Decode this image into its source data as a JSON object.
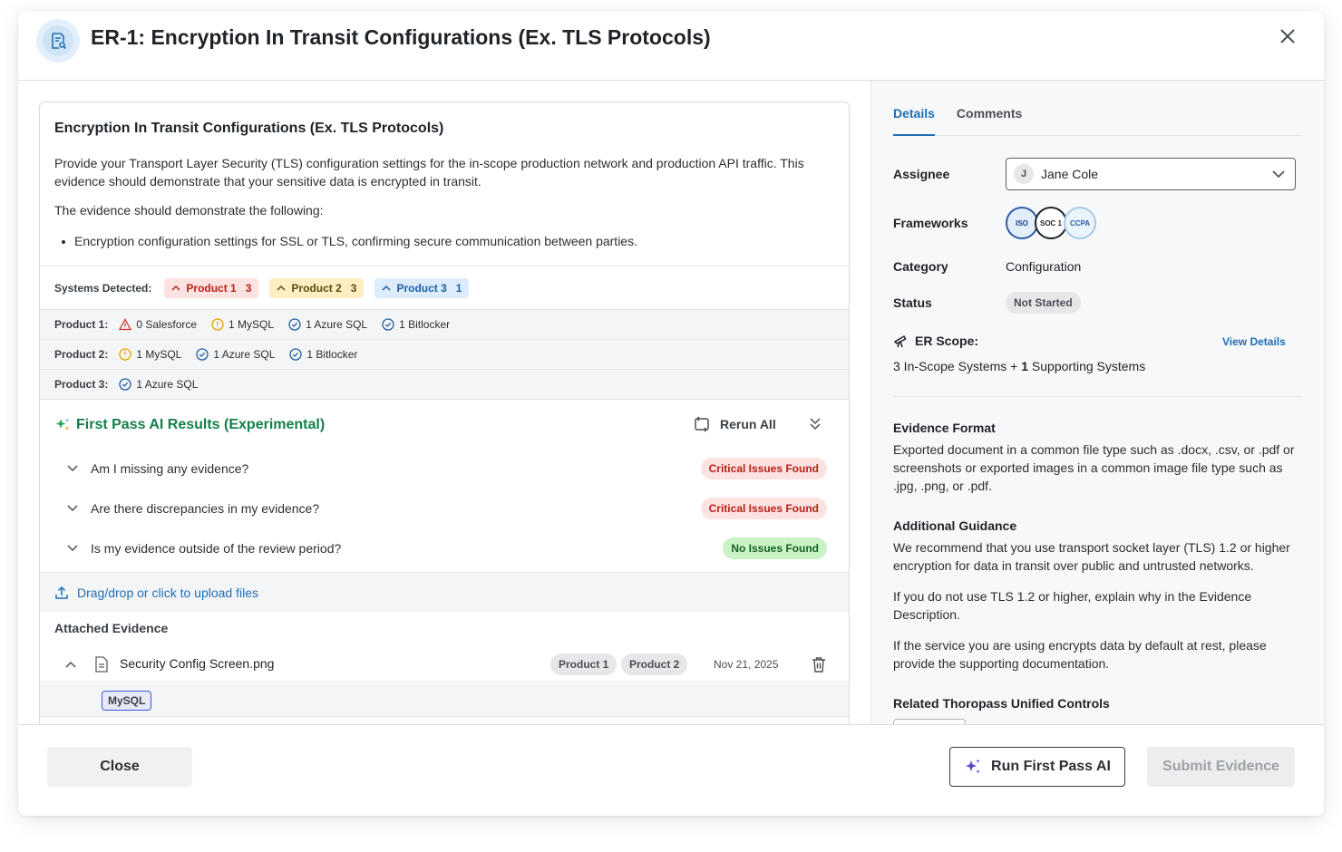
{
  "header": {
    "title": "ER-1: Encryption In Transit Configurations (Ex. TLS Protocols)"
  },
  "card": {
    "title": "Encryption In Transit Configurations (Ex. TLS Protocols)",
    "description": "Provide your Transport Layer Security (TLS) configuration settings for the in-scope production network and production API traffic. This evidence should demonstrate that your sensitive data is encrypted in transit.",
    "demonstrate_intro": "The evidence should demonstrate the following:",
    "bullet": "Encryption configuration settings for SSL or TLS, confirming secure communication between parties."
  },
  "systems": {
    "label": "Systems Detected:",
    "chips": [
      {
        "name": "Product 1",
        "count": "3",
        "color": "#fde2e2"
      },
      {
        "name": "Product 2",
        "count": "3",
        "color": "#fdefc2"
      },
      {
        "name": "Product 3",
        "count": "1",
        "color": "#dcecfb"
      }
    ]
  },
  "products": [
    {
      "label": "Product 1:",
      "items": [
        {
          "icon": "warning-triangle-icon",
          "text": "0 Salesforce"
        },
        {
          "icon": "exclamation-circle-icon",
          "text": "1 MySQL"
        },
        {
          "icon": "check-circle-icon",
          "text": "1 Azure SQL"
        },
        {
          "icon": "check-circle-icon",
          "text": "1 Bitlocker"
        }
      ]
    },
    {
      "label": "Product 2:",
      "items": [
        {
          "icon": "exclamation-circle-icon",
          "text": "1 MySQL"
        },
        {
          "icon": "check-circle-icon",
          "text": "1 Azure SQL"
        },
        {
          "icon": "check-circle-icon",
          "text": "1 Bitlocker"
        }
      ]
    },
    {
      "label": "Product 3:",
      "items": [
        {
          "icon": "check-circle-icon",
          "text": "1 Azure SQL"
        }
      ]
    }
  ],
  "ai": {
    "title": "First Pass AI Results (Experimental)",
    "rerun_label": "Rerun All",
    "questions": [
      {
        "text": "Am I missing any evidence?",
        "status": "Critical Issues Found"
      },
      {
        "text": "Are there discrepancies in my evidence?",
        "status": "Critical Issues Found"
      },
      {
        "text": "Is my evidence outside of the review period?",
        "status": "No Issues Found"
      }
    ]
  },
  "upload": {
    "label": "Drag/drop or click to upload files"
  },
  "attached": {
    "label": "Attached Evidence",
    "file": {
      "name": "Security Config Screen.png",
      "tags": [
        "Product 1",
        "Product 2"
      ],
      "date": "Nov 21, 2025",
      "system_tag": "MySQL"
    }
  },
  "details": {
    "tabs": [
      "Details",
      "Comments"
    ],
    "assignee_label": "Assignee",
    "assignee_initial": "J",
    "assignee_name": "Jane Cole",
    "frameworks_label": "Frameworks",
    "frameworks": [
      "ISO",
      "SOC 1",
      "CCPA"
    ],
    "category_label": "Category",
    "category_value": "Configuration",
    "status_label": "Status",
    "status_value": "Not Started",
    "scope_label": "ER Scope:",
    "view_details": "View Details",
    "scope_prefix": "3 In-Scope Systems + ",
    "scope_bold": "1",
    "scope_suffix": " Supporting Systems",
    "evidence_format_label": "Evidence Format",
    "evidence_format_text": "Exported document in a common file type such as .docx, .csv, or .pdf or screenshots or exported images in a common image file type such as .jpg, .png, or .pdf.",
    "guidance_label": "Additional Guidance",
    "guidance_text_1": "We recommend that you use transport socket layer (TLS) 1.2 or higher encryption for data in transit over public and untrusted networks.",
    "guidance_text_2": "If you do not use TLS 1.2 or higher, explain why in the Evidence Description.",
    "guidance_text_3": "If the service you are using encrypts data by default at rest, please provide the supporting documentation.",
    "controls_label": "Related Thoropass Unified Controls"
  },
  "footer": {
    "close_label": "Close",
    "run_label": "Run First Pass AI",
    "submit_label": "Submit Evidence"
  },
  "colors": {
    "accent": "#1f6fb5",
    "ai_green": "#137f4a",
    "critical": "#b42318",
    "ok": "#17612a"
  }
}
